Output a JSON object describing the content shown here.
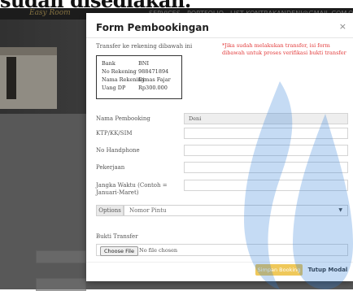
{
  "caption": "sudah disediakan.",
  "site": {
    "logo": "Easy Room",
    "nav": [
      "SERVICES",
      "PORTFOLIO",
      "LIST KONTRAKAN",
      "DENI@GMAIL.COM",
      "LO"
    ]
  },
  "modal": {
    "title": "Form Pembookingan",
    "close_icon": "×",
    "transfer_text": "Transfer ke rekening dibawah ini",
    "notice": "*Jika sudah melakukan transfer, isi form dibawah untuk proses verifikasi bukti transfer",
    "bank": [
      {
        "key": "Bank",
        "value": "BNI"
      },
      {
        "key": "No Rekening",
        "value": "988471894"
      },
      {
        "key": "Nama Rekening",
        "value": "Dimas Fajar"
      },
      {
        "key": "Uang DP",
        "value": "Rp300.000"
      }
    ],
    "fields": {
      "nama_label": "Nama Pembooking",
      "nama_value": "Deni",
      "ktp_label": "KTP/KK/SIM",
      "ktp_value": "",
      "hp_label": "No Handphone",
      "hp_value": "",
      "pekerjaan_label": "Pekerjaan",
      "pekerjaan_value": "",
      "jangka_label": "Jangka Waktu (Contoh = Januari-Maret)",
      "jangka_value": ""
    },
    "options_label": "Options",
    "select_value": "Nomor Pintu",
    "upload_label": "Bukti Transfer",
    "file_button": "Choose File",
    "file_status": "No file chosen",
    "save_button": "Simpan Booking",
    "close_button": "Tutup Modal"
  },
  "colors": {
    "save_button": "#efc85a",
    "notice": "#e23b3b",
    "watermark": "#2f7fd6"
  }
}
